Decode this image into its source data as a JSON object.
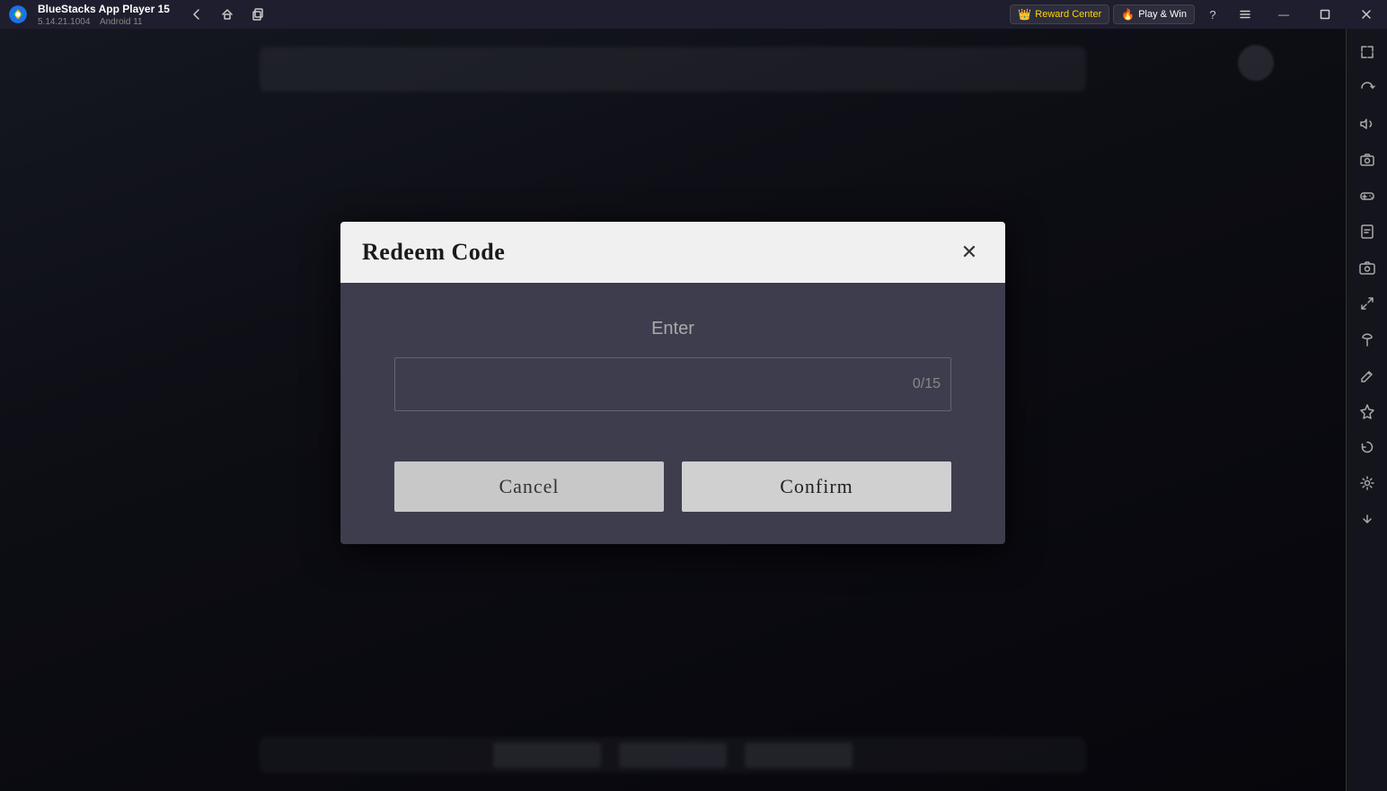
{
  "app": {
    "name": "BlueStacks App Player 15",
    "version": "5.14.21.1004",
    "platform": "Android 11"
  },
  "titlebar": {
    "nav": {
      "back_label": "←",
      "home_label": "⌂",
      "copy_label": "⧉"
    },
    "reward_center": {
      "label": "Reward Center",
      "icon": "👑"
    },
    "play_win": {
      "label": "Play & Win",
      "icon": "🔥"
    },
    "controls": {
      "help_label": "?",
      "menu_label": "≡",
      "minimize_label": "—",
      "maximize_label": "□",
      "close_label": "✕",
      "expand_label": "⛶"
    }
  },
  "sidebar": {
    "buttons": [
      {
        "name": "expand-icon",
        "symbol": "⛶"
      },
      {
        "name": "rotate-icon",
        "symbol": "↺"
      },
      {
        "name": "volume-icon",
        "symbol": "🔊"
      },
      {
        "name": "screenshot-icon",
        "symbol": "📷"
      },
      {
        "name": "gamepad-icon",
        "symbol": "🎮"
      },
      {
        "name": "apk-icon",
        "symbol": "📦"
      },
      {
        "name": "camera-icon",
        "symbol": "📸"
      },
      {
        "name": "resize-icon",
        "symbol": "⤢"
      },
      {
        "name": "eco-icon",
        "symbol": "🌿"
      },
      {
        "name": "edit-icon",
        "symbol": "✏"
      },
      {
        "name": "airplane-icon",
        "symbol": "✈"
      },
      {
        "name": "refresh-icon",
        "symbol": "↻"
      },
      {
        "name": "settings-icon",
        "symbol": "⚙"
      },
      {
        "name": "bottom-icon",
        "symbol": "⬇"
      }
    ]
  },
  "dialog": {
    "title": "Redeem Code",
    "close_label": "✕",
    "enter_label": "Enter",
    "input": {
      "value": "",
      "placeholder": "",
      "counter": "0/15"
    },
    "cancel_label": "Cancel",
    "confirm_label": "Confirm"
  }
}
